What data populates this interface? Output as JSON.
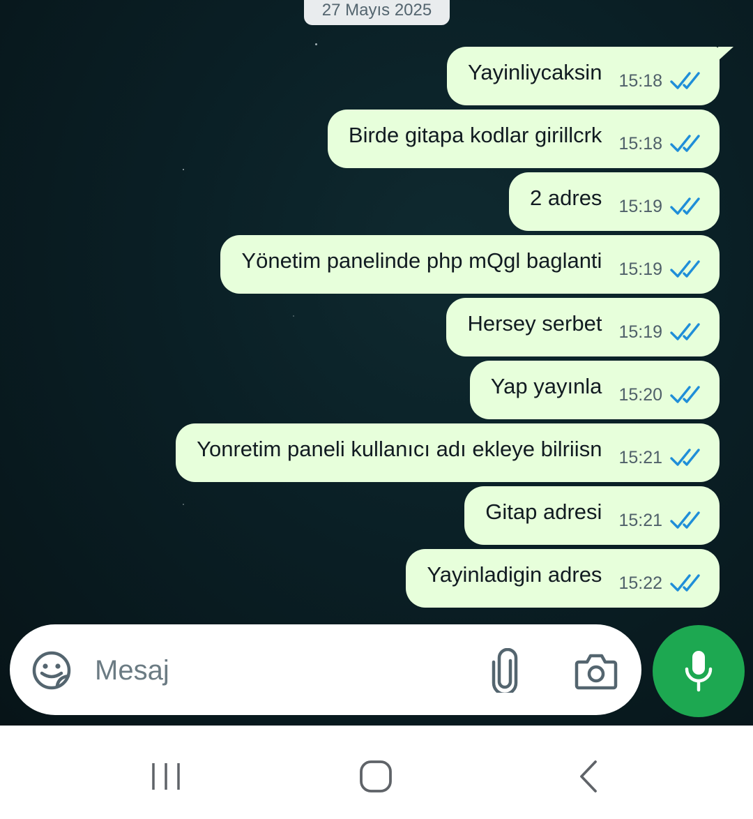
{
  "chat": {
    "date_label": "27 Mayıs 2025",
    "messages": [
      {
        "text": "Yayinliycaksin",
        "time": "15:18",
        "status": "read"
      },
      {
        "text": "Birde gitapa kodlar girillcrk",
        "time": "15:18",
        "status": "read"
      },
      {
        "text": "2 adres",
        "time": "15:19",
        "status": "read"
      },
      {
        "text": "Yönetim panelinde php mQgl baglanti",
        "time": "15:19",
        "status": "read"
      },
      {
        "text": "Hersey serbet",
        "time": "15:19",
        "status": "read"
      },
      {
        "text": "Yap yayınla",
        "time": "15:20",
        "status": "read"
      },
      {
        "text": "Yonretim paneli kullanıcı adı ekleye bilriisn",
        "time": "15:21",
        "status": "read"
      },
      {
        "text": "Gitap adresi",
        "time": "15:21",
        "status": "read"
      },
      {
        "text": "Yayinladigin adres",
        "time": "15:22",
        "status": "read"
      }
    ]
  },
  "composer": {
    "placeholder": "Mesaj",
    "value": "",
    "icons": [
      "sticker-icon",
      "paperclip-icon",
      "camera-icon",
      "microphone-icon"
    ]
  },
  "navbar": {
    "icons": [
      "recents-icon",
      "home-icon",
      "back-icon"
    ]
  },
  "colors": {
    "bubble_out": "#e7ffdb",
    "read_tick": "#1f8ed8",
    "mic_button": "#1da851",
    "chat_background": "#0a1f25"
  }
}
